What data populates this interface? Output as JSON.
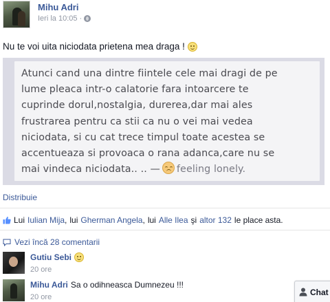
{
  "post": {
    "author": "Mihu Adri",
    "timestamp": "Ieri la 10:05",
    "separator": "·",
    "privacy_icon": "globe-icon",
    "status_text": "Nu te voi uita niciodata prietena mea draga !"
  },
  "shared_image": {
    "quote": "Atunci cand una dintre fiintele cele mai dragi de pe\nlume pleaca intr-o calatorie fara intoarcere te\ncuprinde dorul,nostalgia, durerea,dar mai ales\nfrustrarea pentru ca stii ca nu o vei mai vedea\nniciodata, si cu cat trece timpul toate acestea se\naccentueaza si provoaca o rana adanca,care nu se\nmai vindeca niciodata.. .. —",
    "feeling": "feeling lonely."
  },
  "actions": {
    "share": "Distribuie"
  },
  "likes": {
    "prefix": "Lui",
    "person1": "Iulian Mija",
    "sep1": ",",
    "lui2": "lui",
    "person2": "Gherman Angela",
    "sep2": ",",
    "lui3": "lui",
    "person3": "Alle Ilea",
    "conj": "şi",
    "others": "altor 132",
    "suffix": "le place asta."
  },
  "comments_section": {
    "more_label": "Vezi încă 28 comentarii",
    "items": [
      {
        "author": "Gutiu Sebi",
        "text": "",
        "time": "20 ore"
      },
      {
        "author": "Mihu Adri",
        "text": "Sa o odihneasca Dumnezeu !!!",
        "time": "20 ore"
      }
    ]
  },
  "chat": {
    "label": "Chat"
  },
  "colors": {
    "link": "#3b5998",
    "meta": "#9197a3",
    "text": "#141823",
    "image_bg": "#dbdbe5"
  }
}
